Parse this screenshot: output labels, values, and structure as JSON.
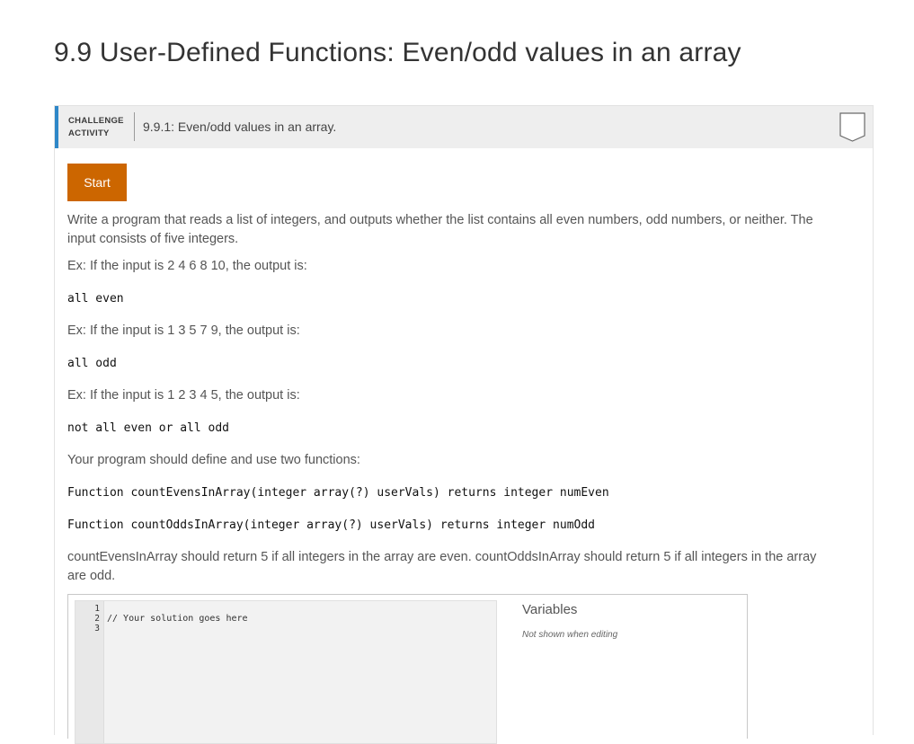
{
  "page": {
    "title": "9.9 User-Defined Functions: Even/odd values in an array"
  },
  "activity": {
    "type_line1": "CHALLENGE",
    "type_line2": "ACTIVITY",
    "title": "9.9.1: Even/odd values in an array.",
    "accent_color": "#2e87c8"
  },
  "start_button": {
    "label": "Start",
    "color": "#cc6600"
  },
  "instructions": {
    "intro": "Write a program that reads a list of integers, and outputs whether the list contains all even numbers, odd numbers, or neither. The input consists of five integers.",
    "example1_prompt": "Ex: If the input is 2 4 6 8 10, the output is:",
    "example1_output": "all even",
    "example2_prompt": "Ex: If the input is 1 3 5 7 9, the output is:",
    "example2_output": "all odd",
    "example3_prompt": "Ex: If the input is 1 2 3 4 5, the output is:",
    "example3_output": "not all even or all odd",
    "functions_intro": "Your program should define and use two functions:",
    "function1": "Function countEvensInArray(integer array(?) userVals) returns integer numEven",
    "function2": "Function countOddsInArray(integer array(?) userVals) returns integer numOdd",
    "closing": "countEvensInArray should return 5 if all integers in the array are even. countOddsInArray should return 5 if all integers in the array are odd."
  },
  "editor": {
    "line_numbers": [
      "1",
      "2",
      "3"
    ],
    "code": "// Your solution goes here"
  },
  "variables": {
    "title": "Variables",
    "note": "Not shown when editing"
  }
}
